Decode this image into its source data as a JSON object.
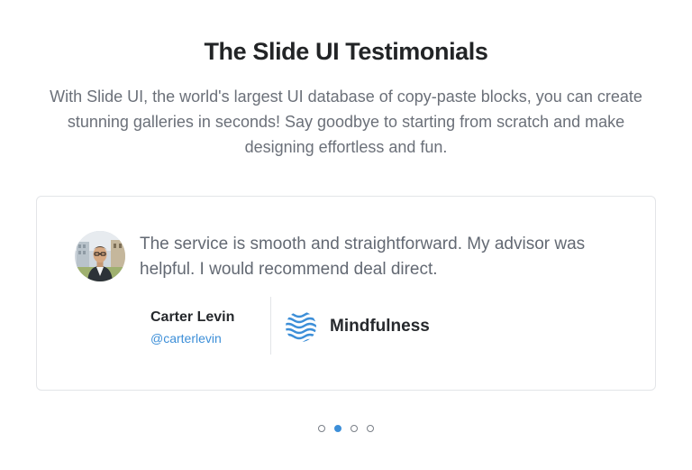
{
  "header": {
    "title": "The Slide UI Testimonials",
    "subtitle": "With Slide UI, the world's largest UI database of copy-paste blocks, you can create stunning galleries in seconds! Say goodbye to starting from scratch and make designing effortless and fun."
  },
  "testimonial": {
    "quote": "The service is smooth and straightforward. My advisor was helpful. I would recommend deal direct.",
    "author_name": "Carter Levin",
    "author_handle": "@carterlevin",
    "company_name": "Mindfulness",
    "avatar_icon": "person-avatar-photo",
    "company_icon": "waves-logo-icon"
  },
  "pagination": {
    "total": 4,
    "active_index": 1
  },
  "colors": {
    "accent": "#3d8fd8",
    "title": "#222426",
    "body_text": "#6b7079",
    "border": "#e3e5e8"
  }
}
